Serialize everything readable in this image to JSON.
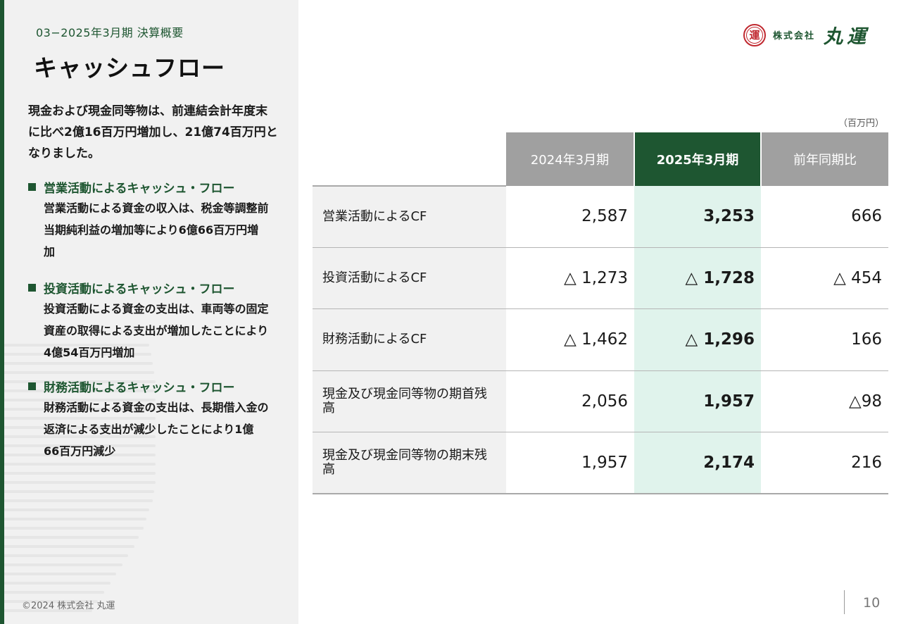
{
  "header": {
    "section_label": "03−2025年3月期  決算概要",
    "title": "キャッシュフロー"
  },
  "summary": "現金および現金同等物は、前連結会計年度末に比べ2億16百万円増加し、21億74百万円となりました。",
  "bullets": [
    {
      "heading": "営業活動によるキャッシュ・フロー",
      "body": "営業活動による資金の収入は、税金等調整前当期純利益の増加等により6億66百万円増加"
    },
    {
      "heading": "投資活動によるキャッシュ・フロー",
      "body": "投資活動による資金の支出は、車両等の固定資産の取得による支出が増加したことにより4億54百万円増加"
    },
    {
      "heading": "財務活動によるキャッシュ・フロー",
      "body": "財務活動による資金の支出は、長期借入金の返済による支出が減少したことにより1億66百万円減少"
    }
  ],
  "logo": {
    "seal_char": "運",
    "kabushiki": "株式会社",
    "name": "丸運",
    "colors": {
      "seal": "#c0282f",
      "brand": "#1e5631"
    }
  },
  "table": {
    "unit": "（百万円）",
    "headers": [
      "2024年3月期",
      "2025年3月期",
      "前年同期比"
    ],
    "rows": [
      {
        "label": "営業活動によるCF",
        "prev": "2,587",
        "cur": "3,253",
        "diff": "666"
      },
      {
        "label": "投資活動によるCF",
        "prev": "△ 1,273",
        "cur": "△ 1,728",
        "diff": "△ 454"
      },
      {
        "label": "財務活動によるCF",
        "prev": "△ 1,462",
        "cur": "△ 1,296",
        "diff": "166"
      },
      {
        "label": "現金及び現金同等物の期首残高",
        "prev": "2,056",
        "cur": "1,957",
        "diff": "△98"
      },
      {
        "label": "現金及び現金同等物の期末残高",
        "prev": "1,957",
        "cur": "2,174",
        "diff": "216"
      }
    ]
  },
  "footer": {
    "copyright": "©2024  株式会社 丸運",
    "page_number": "10"
  },
  "colors": {
    "accent": "#1e5631",
    "header_gray": "#a0a0a0",
    "highlight_column": "#e0f3ec",
    "panel_bg": "#f1f1f1"
  }
}
